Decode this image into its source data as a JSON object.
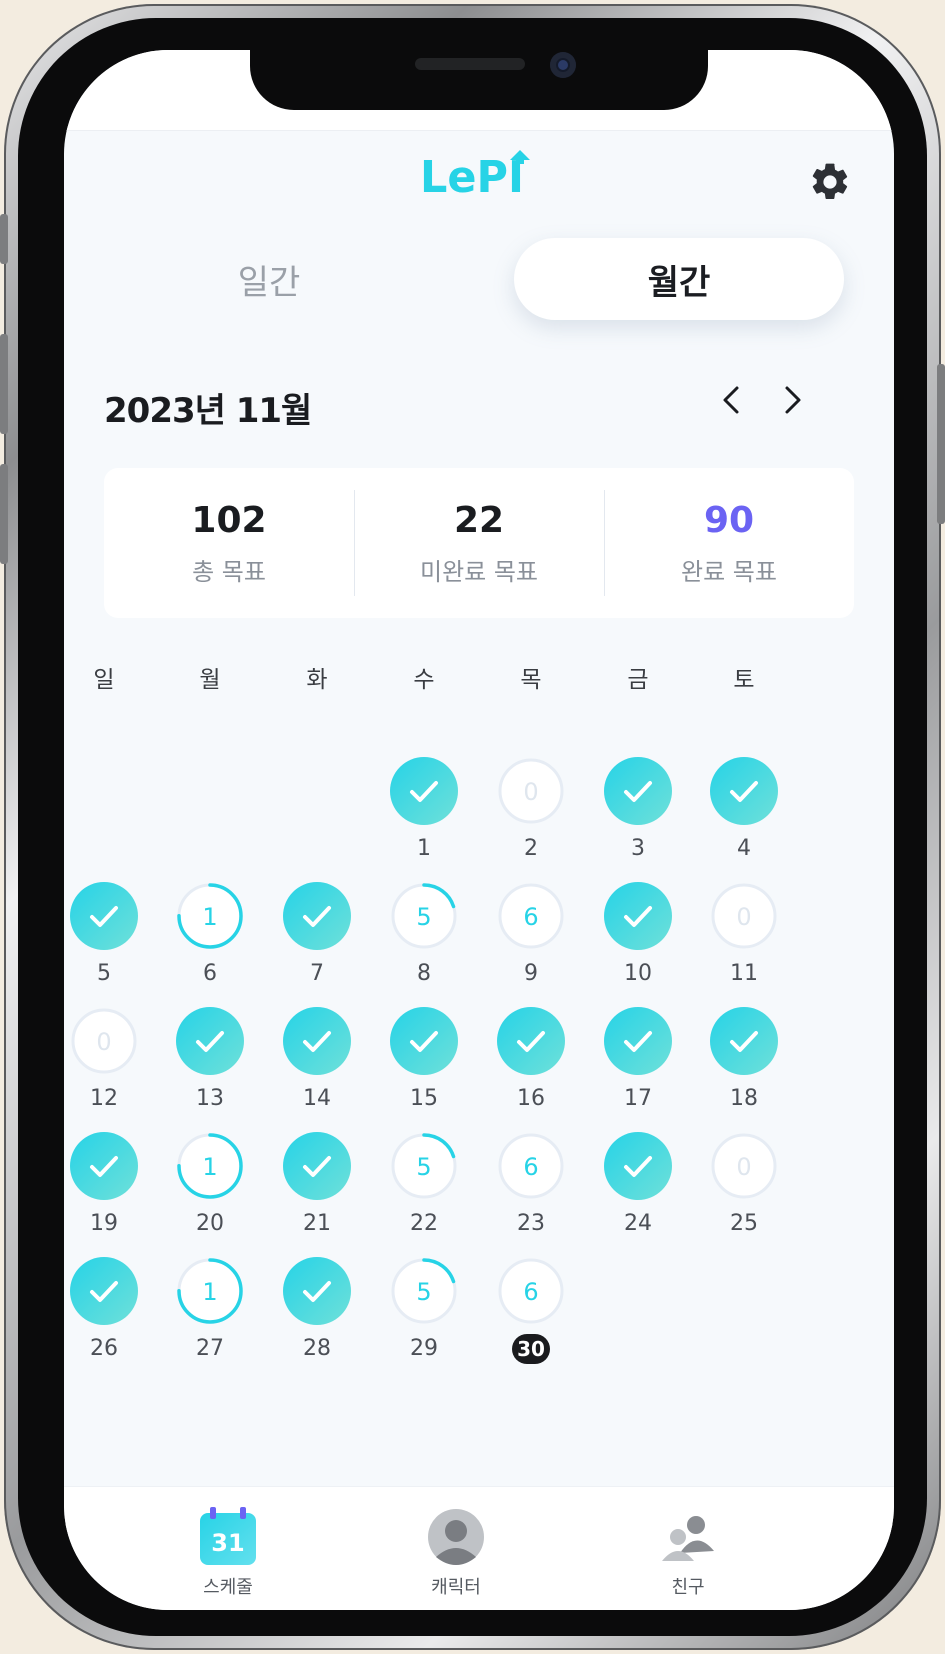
{
  "header": {
    "logo": "LePI",
    "settings_icon": "gear-icon"
  },
  "view_toggle": {
    "daily_label": "일간",
    "monthly_label": "월간",
    "selected": "monthly"
  },
  "month_nav": {
    "title": "2023년 11월",
    "prev_icon": "chevron-left-icon",
    "next_icon": "chevron-right-icon"
  },
  "stats": {
    "total": {
      "value": "102",
      "label": "총 목표"
    },
    "incomplete": {
      "value": "22",
      "label": "미완료 목표"
    },
    "complete": {
      "value": "90",
      "label": "완료 목표"
    }
  },
  "colors": {
    "accent": "#27d3e6",
    "complete": "#6b63f3",
    "ring_empty": "#e6ecf4"
  },
  "calendar": {
    "weekdays": [
      "일",
      "월",
      "화",
      "수",
      "목",
      "금",
      "토"
    ],
    "first_weekday_index": 3,
    "today": 30,
    "days": [
      {
        "day": "1",
        "status": "done"
      },
      {
        "day": "2",
        "status": "pending",
        "count": "0",
        "progress": 0
      },
      {
        "day": "3",
        "status": "done"
      },
      {
        "day": "4",
        "status": "done"
      },
      {
        "day": "5",
        "status": "done"
      },
      {
        "day": "6",
        "status": "pending",
        "count": "1",
        "progress": 0.75
      },
      {
        "day": "7",
        "status": "done"
      },
      {
        "day": "8",
        "status": "pending",
        "count": "5",
        "progress": 0.2
      },
      {
        "day": "9",
        "status": "pending",
        "count": "6",
        "progress": 0
      },
      {
        "day": "10",
        "status": "done"
      },
      {
        "day": "11",
        "status": "pending",
        "count": "0",
        "progress": 0
      },
      {
        "day": "12",
        "status": "pending",
        "count": "0",
        "progress": 0
      },
      {
        "day": "13",
        "status": "done"
      },
      {
        "day": "14",
        "status": "done"
      },
      {
        "day": "15",
        "status": "done"
      },
      {
        "day": "16",
        "status": "done"
      },
      {
        "day": "17",
        "status": "done"
      },
      {
        "day": "18",
        "status": "done"
      },
      {
        "day": "19",
        "status": "done"
      },
      {
        "day": "20",
        "status": "pending",
        "count": "1",
        "progress": 0.75
      },
      {
        "day": "21",
        "status": "done"
      },
      {
        "day": "22",
        "status": "pending",
        "count": "5",
        "progress": 0.2
      },
      {
        "day": "23",
        "status": "pending",
        "count": "6",
        "progress": 0
      },
      {
        "day": "24",
        "status": "done"
      },
      {
        "day": "25",
        "status": "pending",
        "count": "0",
        "progress": 0
      },
      {
        "day": "26",
        "status": "done"
      },
      {
        "day": "27",
        "status": "pending",
        "count": "1",
        "progress": 0.75
      },
      {
        "day": "28",
        "status": "done"
      },
      {
        "day": "29",
        "status": "pending",
        "count": "5",
        "progress": 0.2
      },
      {
        "day": "30",
        "status": "pending",
        "count": "6",
        "progress": 0
      }
    ]
  },
  "tabbar": {
    "schedule": {
      "label": "스케줄",
      "badge": "31",
      "icon": "calendar-icon",
      "active": true
    },
    "character": {
      "label": "캐릭터",
      "icon": "character-icon"
    },
    "friends": {
      "label": "친구",
      "icon": "friends-icon"
    }
  }
}
